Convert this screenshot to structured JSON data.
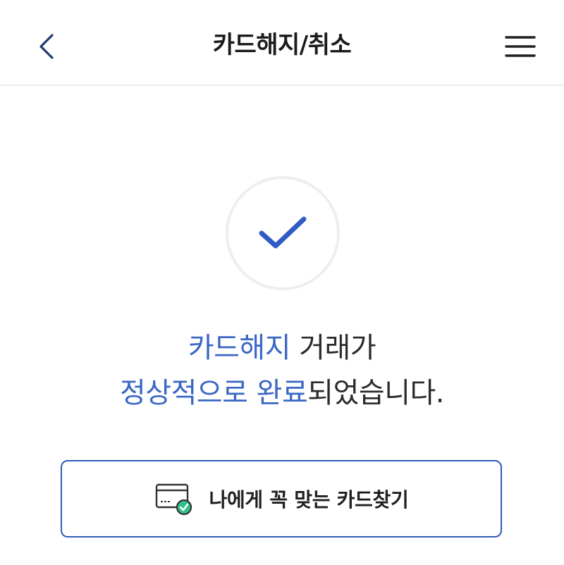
{
  "header": {
    "title": "카드해지/취소",
    "back_icon": "chevron-left-icon",
    "menu_icon": "hamburger-menu-icon"
  },
  "result": {
    "status_icon": "check-icon",
    "line1_highlight": "카드해지",
    "line1_rest": " 거래가",
    "line2_highlight": "정상적으로 완료",
    "line2_rest": "되었습니다."
  },
  "action": {
    "find_card_label": "나에게 꼭 맞는 카드찾기",
    "find_card_icon": "credit-card-check-icon"
  },
  "colors": {
    "accent": "#3a67c4",
    "check": "#2f5cc4",
    "button_border": "#2f5bb7",
    "icon_green": "#2fc08a"
  }
}
